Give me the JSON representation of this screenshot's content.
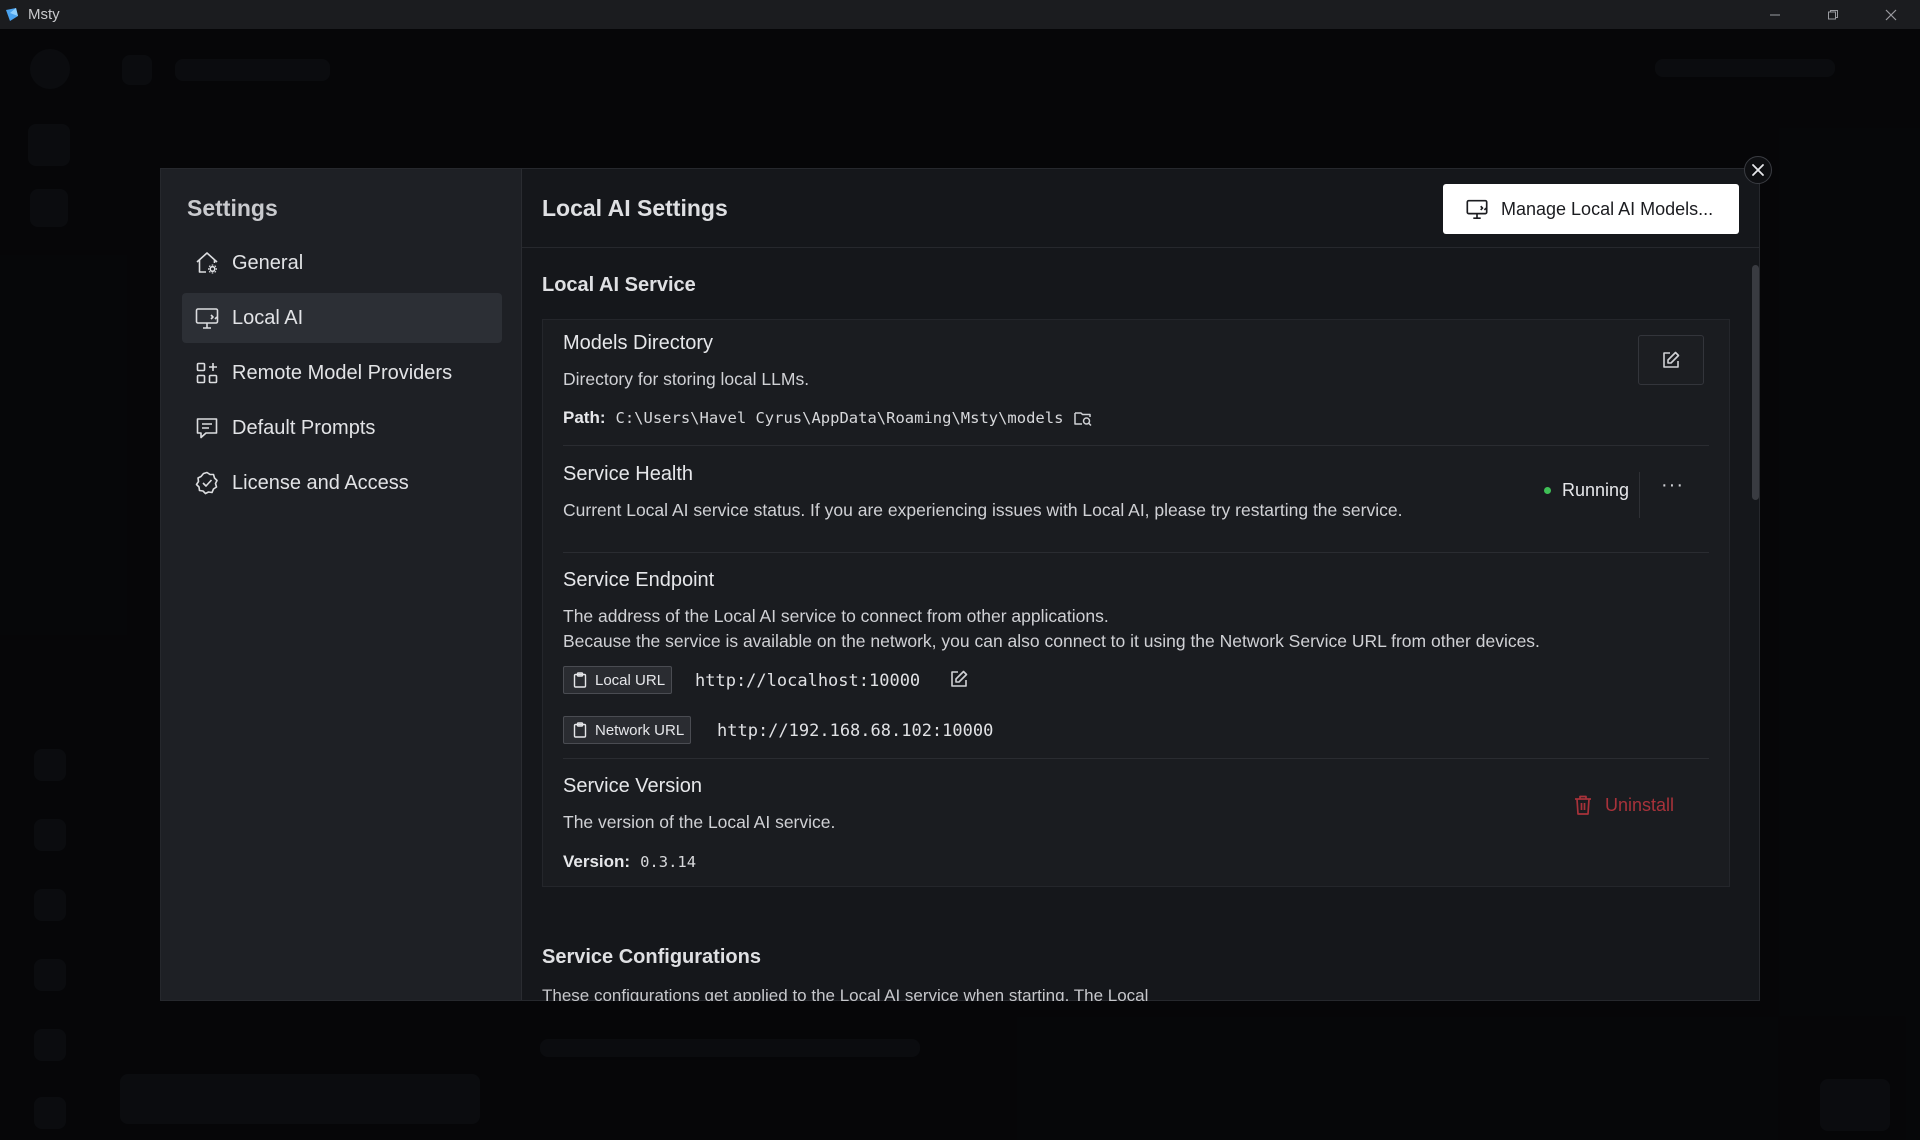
{
  "window": {
    "title": "Msty",
    "controls": [
      "minimize-icon",
      "restore-icon",
      "close-icon"
    ]
  },
  "settings": {
    "title": "Settings",
    "nav": [
      {
        "label": "General",
        "icon": "home-gear-icon",
        "active": false
      },
      {
        "label": "Local AI",
        "icon": "monitor-icon",
        "active": true
      },
      {
        "label": "Remote Model Providers",
        "icon": "grid-plus-icon",
        "active": false
      },
      {
        "label": "Default Prompts",
        "icon": "message-lines-icon",
        "active": false
      },
      {
        "label": "License and Access",
        "icon": "badge-check-icon",
        "active": false
      }
    ]
  },
  "main": {
    "title": "Local AI Settings",
    "manage_button": "Manage Local AI Models..."
  },
  "service": {
    "section_title": "Local AI Service",
    "models_dir": {
      "title": "Models Directory",
      "desc": "Directory for storing local LLMs.",
      "path_label": "Path:",
      "path_value": "C:\\Users\\Havel Cyrus\\AppData\\Roaming\\Msty\\models"
    },
    "health": {
      "title": "Service Health",
      "desc": "Current Local AI service status. If you are experiencing issues with Local AI, please try restarting the service.",
      "status": "Running",
      "status_color": "#3fbf56",
      "more": "···"
    },
    "endpoint": {
      "title": "Service Endpoint",
      "desc1": "The address of the Local AI service to connect from other applications.",
      "desc2": "Because the service is available on the network, you can also connect to it using the Network Service URL from other devices.",
      "local_label": "Local URL",
      "local_value": "http://localhost:10000",
      "network_label": "Network URL",
      "network_value": "http://192.168.68.102:10000"
    },
    "version": {
      "title": "Service Version",
      "desc": "The version of the Local AI service.",
      "label": "Version:",
      "value": "0.3.14",
      "uninstall": "Uninstall",
      "uninstall_color": "#a8323a"
    }
  },
  "configurations": {
    "section_title": "Service Configurations",
    "desc": "These configurations get applied to the Local AI service when starting. The Local"
  }
}
